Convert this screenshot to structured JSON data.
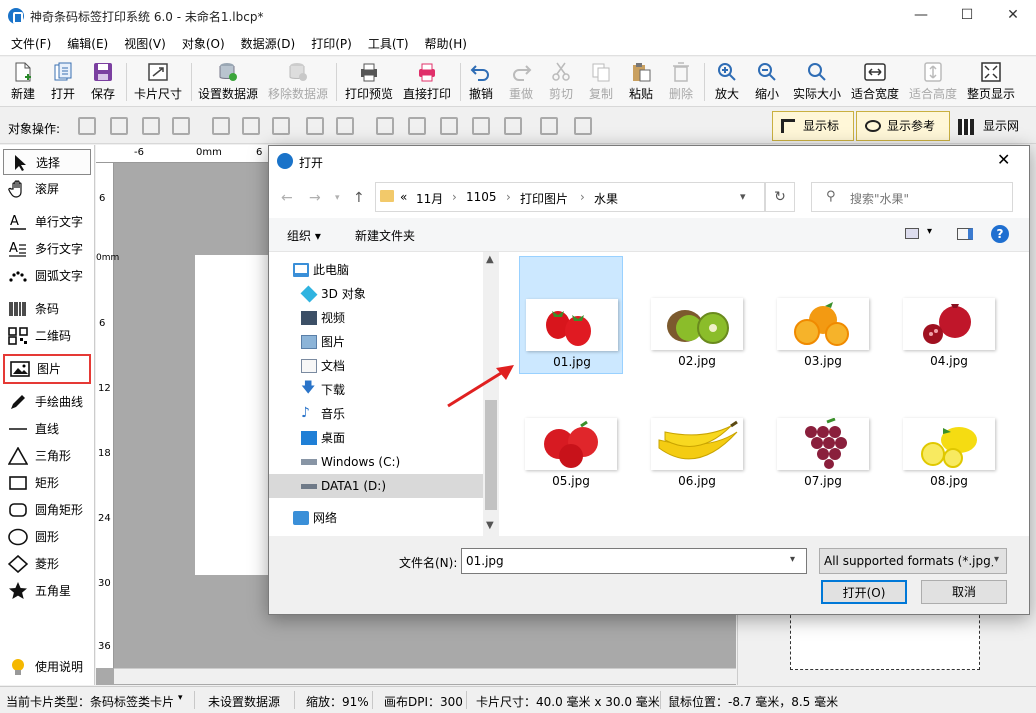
{
  "window": {
    "title": "神奇条码标签打印系统 6.0 - 未命名1.lbcp*",
    "minimize": "—",
    "maximize": "☐",
    "close": "✕"
  },
  "menu": [
    "文件(F)",
    "编辑(E)",
    "视图(V)",
    "对象(O)",
    "数据源(D)",
    "打印(P)",
    "工具(T)",
    "帮助(H)"
  ],
  "toolbar": [
    {
      "label": "新建",
      "icon": "new-file-icon",
      "disabled": false
    },
    {
      "label": "打开",
      "icon": "open-icon",
      "disabled": false
    },
    {
      "label": "保存",
      "icon": "save-icon",
      "disabled": false
    },
    {
      "label": "卡片尺寸",
      "icon": "card-size-icon",
      "disabled": false
    },
    {
      "label": "设置数据源",
      "icon": "database-icon",
      "disabled": false
    },
    {
      "label": "移除数据源",
      "icon": "remove-database-icon",
      "disabled": true
    },
    {
      "label": "打印预览",
      "icon": "print-preview-icon",
      "disabled": false
    },
    {
      "label": "直接打印",
      "icon": "print-icon",
      "disabled": false
    },
    {
      "label": "撤销",
      "icon": "undo-icon",
      "disabled": false
    },
    {
      "label": "重做",
      "icon": "redo-icon",
      "disabled": true
    },
    {
      "label": "剪切",
      "icon": "cut-icon",
      "disabled": true
    },
    {
      "label": "复制",
      "icon": "copy-icon",
      "disabled": true
    },
    {
      "label": "粘贴",
      "icon": "paste-icon",
      "disabled": false
    },
    {
      "label": "删除",
      "icon": "delete-icon",
      "disabled": true
    },
    {
      "label": "放大",
      "icon": "zoom-in-icon",
      "disabled": false
    },
    {
      "label": "缩小",
      "icon": "zoom-out-icon",
      "disabled": false
    },
    {
      "label": "实际大小",
      "icon": "actual-size-icon",
      "disabled": false
    },
    {
      "label": "适合宽度",
      "icon": "fit-width-icon",
      "disabled": false
    },
    {
      "label": "适合高度",
      "icon": "fit-height-icon",
      "disabled": true
    },
    {
      "label": "整页显示",
      "icon": "fit-page-icon",
      "disabled": false
    }
  ],
  "objbar": {
    "label": "对象操作:",
    "show_ruler": "显示标尺",
    "show_guides": "显示参考线",
    "show_grid": "显示网格"
  },
  "palette": [
    {
      "label": "选择",
      "icon": "cursor-icon"
    },
    {
      "label": "滚屏",
      "icon": "hand-icon"
    },
    {
      "label": "单行文字",
      "icon": "single-text-icon"
    },
    {
      "label": "多行文字",
      "icon": "multi-text-icon"
    },
    {
      "label": "圆弧文字",
      "icon": "arc-text-icon"
    },
    {
      "label": "条码",
      "icon": "barcode-icon"
    },
    {
      "label": "二维码",
      "icon": "qrcode-icon"
    },
    {
      "label": "图片",
      "icon": "image-icon"
    },
    {
      "label": "手绘曲线",
      "icon": "pen-icon"
    },
    {
      "label": "直线",
      "icon": "line-icon"
    },
    {
      "label": "三角形",
      "icon": "triangle-icon"
    },
    {
      "label": "矩形",
      "icon": "rectangle-icon"
    },
    {
      "label": "圆角矩形",
      "icon": "rounded-rect-icon"
    },
    {
      "label": "圆形",
      "icon": "circle-icon"
    },
    {
      "label": "菱形",
      "icon": "diamond-icon"
    },
    {
      "label": "五角星",
      "icon": "star-icon"
    }
  ],
  "help": "使用说明",
  "rulers": {
    "top": [
      "-6",
      "0mm",
      "6"
    ],
    "left": [
      "6",
      "0mm",
      "6",
      "12",
      "18",
      "24",
      "30",
      "36"
    ]
  },
  "status": {
    "card_type": "当前卡片类型：条码标签类卡片",
    "datasource": "未设置数据源",
    "zoom": "缩放：91%",
    "dpi": "画布DPI：300",
    "card_size": "卡片尺寸：40.0 毫米 x 30.0 毫米",
    "mouse_pos": "鼠标位置：-8.7 毫米，8.5 毫米"
  },
  "dialog": {
    "title": "打开",
    "breadcrumb": [
      "«",
      "11月",
      "1105",
      "打印图片",
      "水果"
    ],
    "search_placeholder": "搜索\"水果\"",
    "organize": "组织 ▾",
    "new_folder": "新建文件夹",
    "nav": [
      {
        "label": "此电脑",
        "icon": "computer-icon",
        "indent": 0
      },
      {
        "label": "3D 对象",
        "icon": "3d-objects-icon",
        "indent": 1
      },
      {
        "label": "视频",
        "icon": "video-icon",
        "indent": 1
      },
      {
        "label": "图片",
        "icon": "pictures-icon",
        "indent": 1
      },
      {
        "label": "文档",
        "icon": "documents-icon",
        "indent": 1
      },
      {
        "label": "下载",
        "icon": "download-icon",
        "indent": 1
      },
      {
        "label": "音乐",
        "icon": "music-icon",
        "indent": 1
      },
      {
        "label": "桌面",
        "icon": "desktop-icon",
        "indent": 1
      },
      {
        "label": "Windows (C:)",
        "icon": "drive-c-icon",
        "indent": 1
      },
      {
        "label": "DATA1 (D:)",
        "icon": "drive-d-icon",
        "indent": 1
      },
      {
        "label": "网络",
        "icon": "network-icon",
        "indent": 0
      }
    ],
    "files": [
      {
        "name": "01.jpg",
        "fruit": "strawberry"
      },
      {
        "name": "02.jpg",
        "fruit": "kiwi"
      },
      {
        "name": "03.jpg",
        "fruit": "orange"
      },
      {
        "name": "04.jpg",
        "fruit": "pomegranate"
      },
      {
        "name": "05.jpg",
        "fruit": "apple"
      },
      {
        "name": "06.jpg",
        "fruit": "banana"
      },
      {
        "name": "07.jpg",
        "fruit": "grape"
      },
      {
        "name": "08.jpg",
        "fruit": "lemon"
      }
    ],
    "filename_label": "文件名(N):",
    "filename_value": "01.jpg",
    "filetype": "All supported formats (*.jpg,",
    "open_button": "打开(O)",
    "cancel_button": "取消"
  }
}
